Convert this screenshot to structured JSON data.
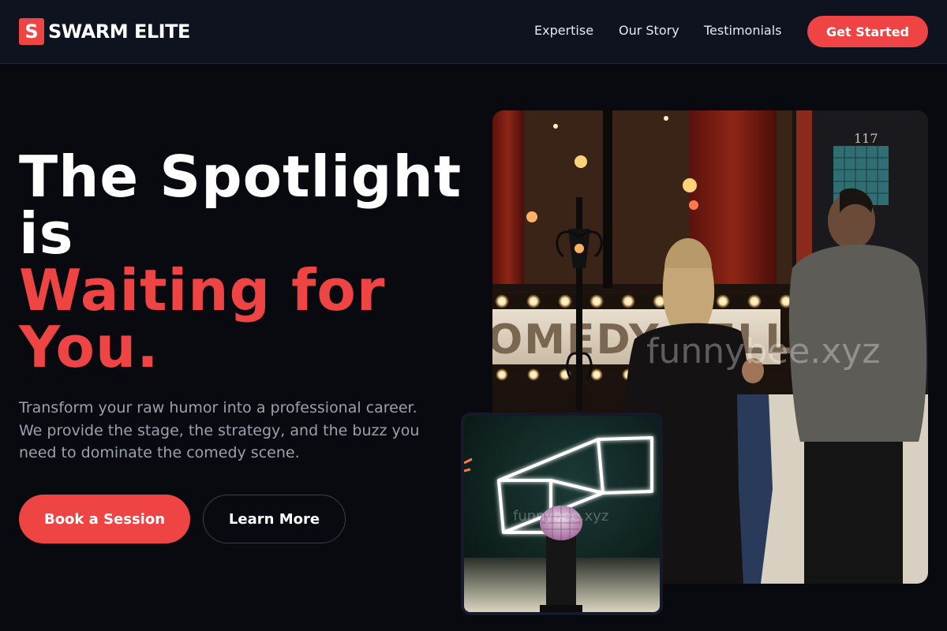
{
  "brand": {
    "mark": "S",
    "name": "SWARM ELITE"
  },
  "nav": {
    "links": [
      "Expertise",
      "Our Story",
      "Testimonials"
    ],
    "cta": "Get Started"
  },
  "hero": {
    "headline_line1": "The Spotlight",
    "headline_line2": "is",
    "headline_accent1": "Waiting for",
    "headline_accent2": "You.",
    "subtext": "Transform your raw humor into a professional career. We provide the stage, the strategy, and the buzz you need to dominate the comedy scene.",
    "primary_button": "Book a Session",
    "secondary_button": "Learn More"
  },
  "images": {
    "main_photo": {
      "sign_text": "OMEDY CELLAR",
      "door_number": "117",
      "watermark": "funnybee.xyz"
    },
    "mic_photo": {
      "watermark": "funnybee.xyz"
    }
  },
  "colors": {
    "accent": "#ef4444",
    "background": "#080a10",
    "nav_background": "#0f1320",
    "muted_text": "#9aa1ae"
  }
}
